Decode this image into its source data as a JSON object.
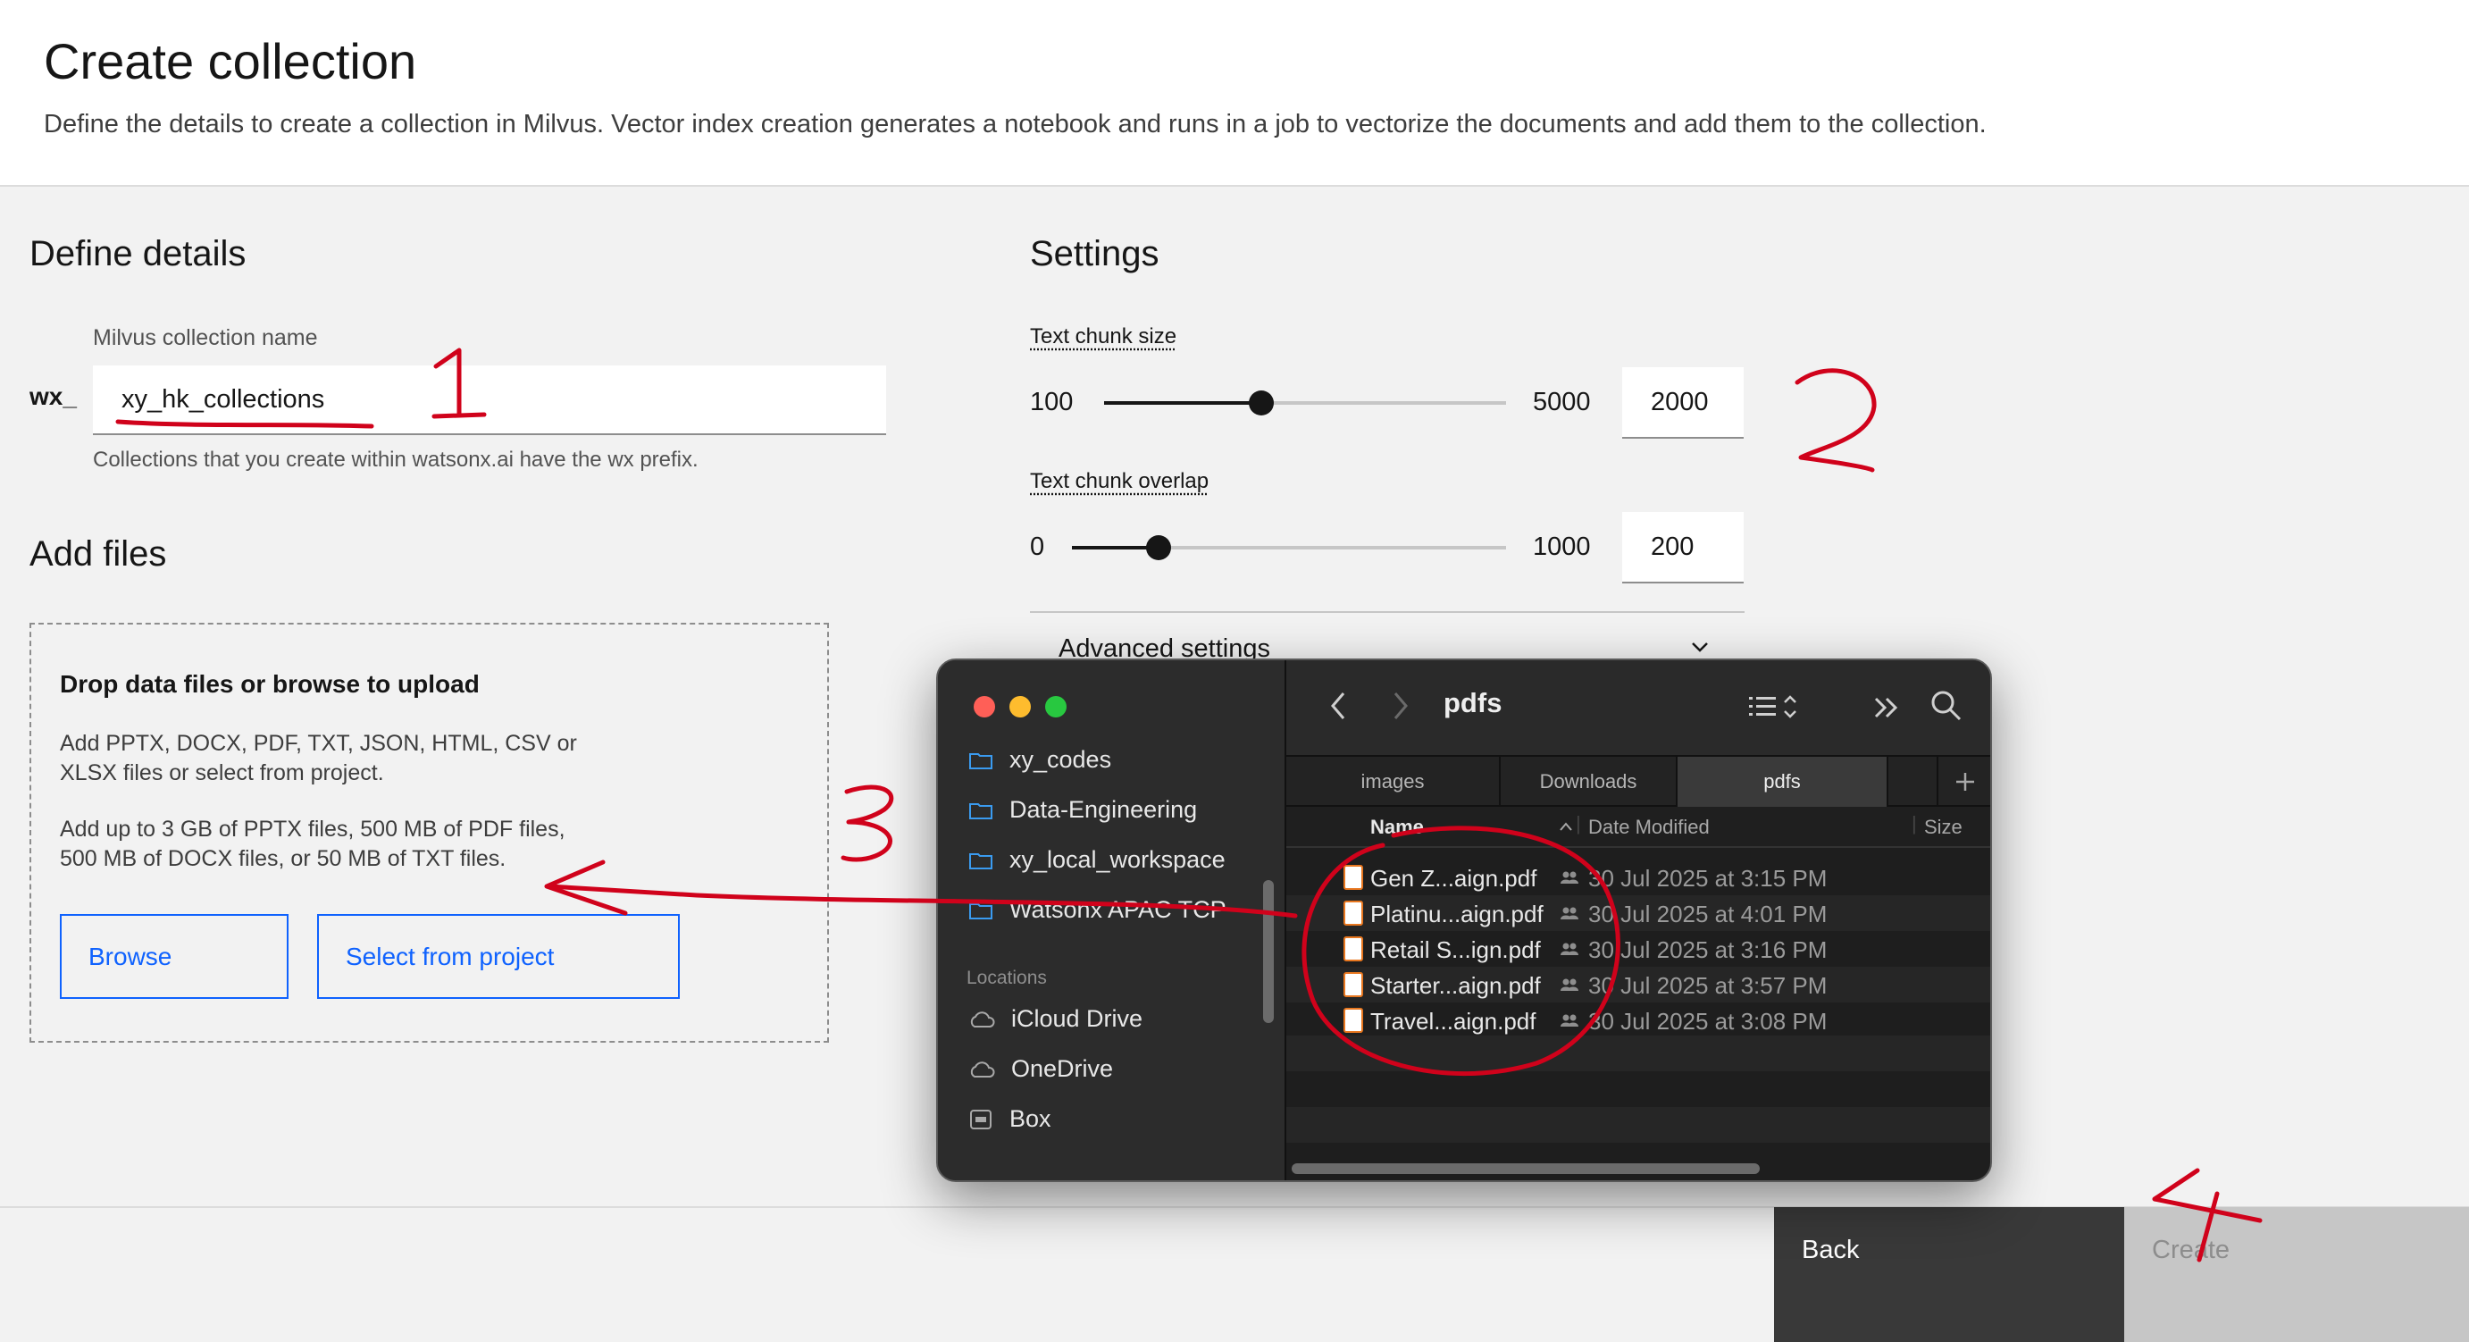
{
  "header": {
    "title": "Create collection",
    "description": "Define the details to create a collection in Milvus. Vector index creation generates a notebook and runs in a job to vectorize the documents and add them to the collection."
  },
  "details": {
    "section_title": "Define details",
    "name_label": "Milvus collection name",
    "prefix": "wx_",
    "name_value": "xy_hk_collections",
    "helper_text": "Collections that you create within watsonx.ai have the wx prefix."
  },
  "files": {
    "section_title": "Add files",
    "drop_title": "Drop data files or browse to upload",
    "line1": "Add PPTX, DOCX, PDF, TXT, JSON, HTML, CSV or",
    "line2": "XLSX files or select from project.",
    "line3": "Add up to 3 GB of PPTX files, 500 MB of PDF files,",
    "line4": "500 MB of DOCX files, or 50 MB of TXT files.",
    "browse_label": "Browse",
    "select_label": "Select from project"
  },
  "settings": {
    "section_title": "Settings",
    "chunk_size": {
      "label": "Text chunk size",
      "min": "100",
      "max": "5000",
      "value": "2000",
      "fraction": 0.39
    },
    "chunk_overlap": {
      "label": "Text chunk overlap",
      "min": "0",
      "max": "1000",
      "value": "200",
      "fraction": 0.2
    },
    "advanced_label": "Advanced settings"
  },
  "footer": {
    "back_label": "Back",
    "create_label": "Create"
  },
  "finder": {
    "current_folder": "pdfs",
    "sidebar_items": [
      "xy_codes",
      "Data-Engineering",
      "xy_local_workspace",
      "Watsonx APAC TCP"
    ],
    "locations_label": "Locations",
    "locations": [
      "iCloud Drive",
      "OneDrive",
      "Box"
    ],
    "tabs": [
      "images",
      "Downloads",
      "pdfs"
    ],
    "columns": {
      "name": "Name",
      "date": "Date Modified",
      "size": "Size"
    },
    "files": [
      {
        "name": "Gen Z...aign.pdf",
        "date": "30 Jul 2025 at 3:15 PM"
      },
      {
        "name": "Platinu...aign.pdf",
        "date": "30 Jul 2025 at 4:01 PM"
      },
      {
        "name": "Retail S...ign.pdf",
        "date": "30 Jul 2025 at 3:16 PM"
      },
      {
        "name": "Starter...aign.pdf",
        "date": "30 Jul 2025 at 3:57 PM"
      },
      {
        "name": "Travel...aign.pdf",
        "date": "30 Jul 2025 at 3:08 PM"
      }
    ]
  },
  "annotations": {
    "color": "#d0021b"
  },
  "colors": {
    "primary": "#0f62fe",
    "footer_dark": "#393939",
    "disabled": "#c6c6c6"
  }
}
